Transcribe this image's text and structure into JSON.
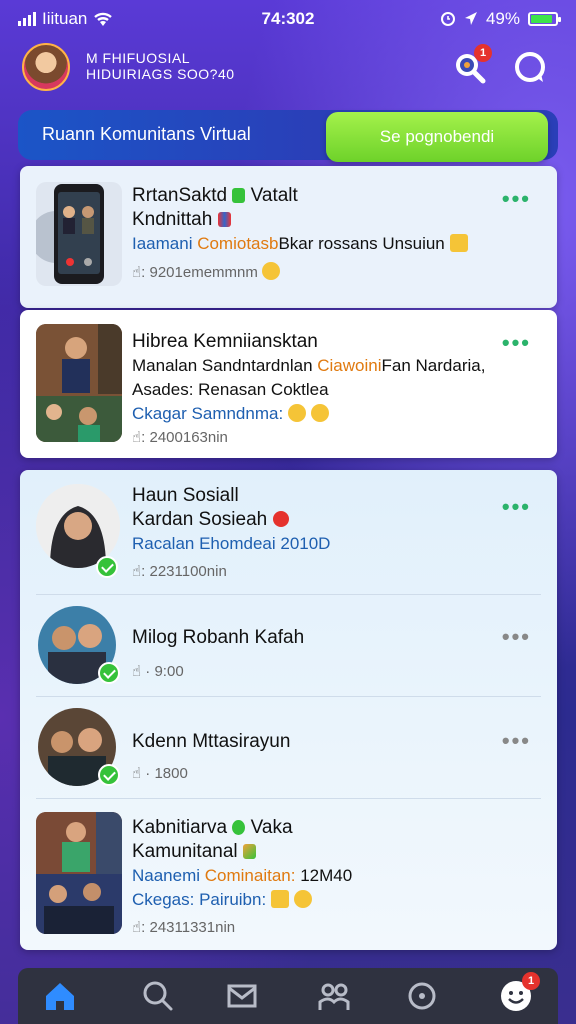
{
  "status_bar": {
    "carrier": "Iiituan",
    "time": "74:302",
    "battery_percent": "49%"
  },
  "header": {
    "profile_line1": "M FHIFUOSIAL",
    "profile_line2": "HIDUIRIAGS SOO?40",
    "notification_count": "1"
  },
  "community": {
    "title": "Ruann Komunitans Virtual",
    "button_label": "Se pognobendi"
  },
  "posts": [
    {
      "title_line1": "RrtanSaktd",
      "title_line1_tail": "Vatalt",
      "title_line2": "Kndnittah",
      "text_a": "Iaamani ",
      "text_b": "Comiotasb",
      "text_c": "Bkar rossans Unsuiun",
      "meta": "9201ememmnm"
    },
    {
      "title": "Hibrea Kemniiansktan",
      "text_line1_a": "Manalan Sandntardnlan ",
      "text_line1_b": "Ciawoini",
      "text_line1_c": "Fan Nardaria,",
      "text_line2": "Asades: Renasan Coktlea",
      "text_line3": "Ckagar Samndnma:",
      "meta": "2400163nin"
    }
  ],
  "group_card": {
    "main": {
      "title": "Haun Sosiall",
      "subtitle": "Kardan Sosieah",
      "text": "Racalan Ehomdeai 2010D",
      "meta": "2231100nin"
    },
    "members": [
      {
        "name": "Milog Robanh Kafah",
        "meta": "9:00"
      },
      {
        "name": "Kdenn Mttasirayun",
        "meta": "1800"
      }
    ],
    "last": {
      "title_line1": "Kabnitiarva",
      "title_line1_tail": "Vaka",
      "title_line2": "Kamunitanal",
      "text_a": "Naanemi ",
      "text_b": "Cominaitan:",
      "text_c": " 12M40",
      "text2": "Ckegas: Pairuibn:",
      "meta": "24311331nin"
    }
  },
  "bottom_nav": {
    "badge": "1"
  },
  "colors": {
    "accent_green": "#6ed22a",
    "accent_blue": "#1e5fb0",
    "accent_orange": "#e07a10",
    "badge_red": "#e5322d"
  }
}
